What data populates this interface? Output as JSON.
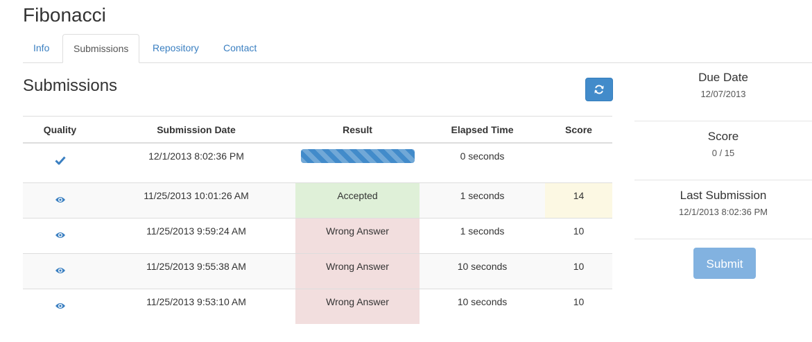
{
  "page": {
    "title": "Fibonacci"
  },
  "tabs": [
    {
      "label": "Info"
    },
    {
      "label": "Submissions",
      "active": true
    },
    {
      "label": "Repository"
    },
    {
      "label": "Contact"
    }
  ],
  "submissions": {
    "heading": "Submissions",
    "refresh_icon": "refresh-icon",
    "columns": [
      "Quality",
      "Submission Date",
      "Result",
      "Elapsed Time",
      "Score"
    ],
    "rows": [
      {
        "quality_icon": "check-icon",
        "date": "12/1/2013 8:02:36 PM",
        "result": "",
        "progress": 1.0,
        "elapsed": "0 seconds",
        "score": ""
      },
      {
        "quality_icon": "eye-icon",
        "date": "11/25/2013 10:01:26 AM",
        "result": "Accepted",
        "elapsed": "1 seconds",
        "score": "14"
      },
      {
        "quality_icon": "eye-icon",
        "date": "11/25/2013 9:59:24 AM",
        "result": "Wrong Answer",
        "elapsed": "1 seconds",
        "score": "10"
      },
      {
        "quality_icon": "eye-icon",
        "date": "11/25/2013 9:55:38 AM",
        "result": "Wrong Answer",
        "elapsed": "10 seconds",
        "score": "10"
      },
      {
        "quality_icon": "eye-icon",
        "date": "11/25/2013 9:53:10 AM",
        "result": "Wrong Answer",
        "elapsed": "10 seconds",
        "score": "10"
      }
    ]
  },
  "sidebar": {
    "due_date_label": "Due Date",
    "due_date_value": "12/07/2013",
    "score_label": "Score",
    "score_value": "0 / 15",
    "last_submission_label": "Last Submission",
    "last_submission_value": "12/1/2013 8:02:36 PM",
    "submit_label": "Submit"
  },
  "colors": {
    "primary": "#428bca",
    "success_bg": "#dff0d8",
    "danger_bg": "#f2dede",
    "warning_bg": "#fcf8e3",
    "submit_disabled": "#82b2e0"
  }
}
